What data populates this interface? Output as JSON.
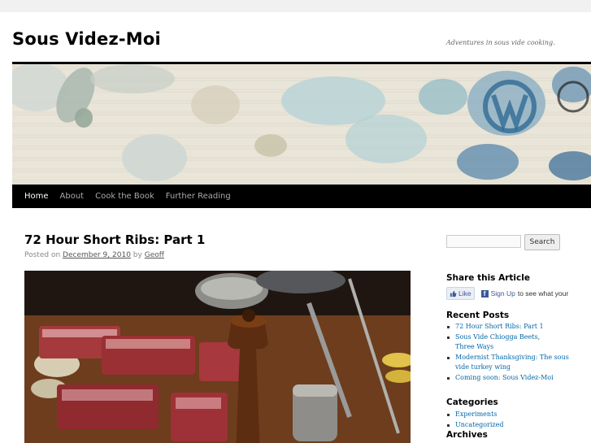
{
  "site": {
    "title": "Sous Videz-Moi",
    "description": "Adventures in sous vide cooking."
  },
  "nav": {
    "items": [
      {
        "label": "Home",
        "current": true
      },
      {
        "label": "About",
        "current": false
      },
      {
        "label": "Cook the Book",
        "current": false
      },
      {
        "label": "Further Reading",
        "current": false
      }
    ]
  },
  "post": {
    "title": "72 Hour Short Ribs: Part 1",
    "meta_prefix": "Posted on",
    "date": "December 9, 2010",
    "meta_by": "by",
    "author": "Geoff"
  },
  "sidebar": {
    "search": {
      "placeholder": "",
      "button_label": "Search"
    },
    "share": {
      "title": "Share this Article",
      "like_label": "Like",
      "signup_label": "Sign Up",
      "signup_text": "to see what your"
    },
    "recent_posts": {
      "title": "Recent Posts",
      "items": [
        "72 Hour Short Ribs: Part 1",
        "Sous Vide Chiogga Beets,",
        "Three Ways",
        "Modernist Thanksgiving: The sous",
        "vide turkey wing",
        "Coming soon: Sous Videz-Moi"
      ]
    },
    "categories": {
      "title": "Categories",
      "items": [
        "Experiments",
        "Uncategorized"
      ]
    },
    "archives": {
      "title": "Archives"
    }
  },
  "colors": {
    "nav_bg": "#000000",
    "link": "#0066aa",
    "facebook": "#3b5998"
  }
}
